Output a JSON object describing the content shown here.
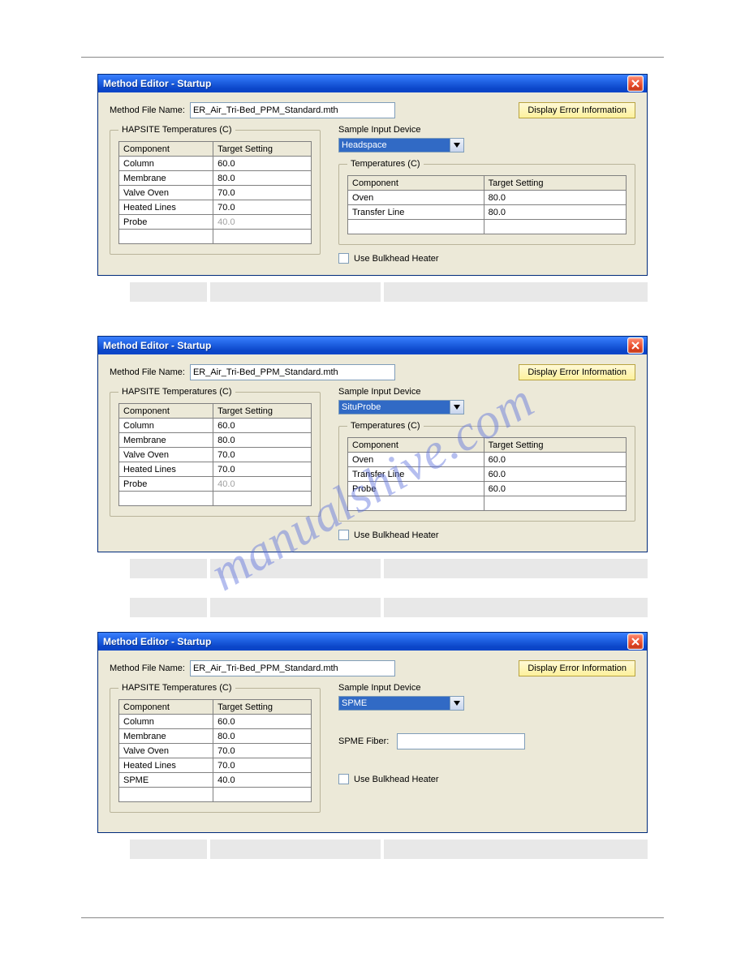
{
  "watermark": "manualshive.com",
  "windows": [
    {
      "title": "Method Editor - Startup",
      "method_label": "Method File Name:",
      "method_value": "ER_Air_Tri-Bed_PPM_Standard.mth",
      "err_button": "Display Error Information",
      "haps_legend": "HAPSITE Temperatures (C)",
      "haps_cols": [
        "Component",
        "Target Setting"
      ],
      "haps_rows": [
        {
          "c": "Column",
          "v": "60.0",
          "dis": false
        },
        {
          "c": "Membrane",
          "v": "80.0",
          "dis": false
        },
        {
          "c": "Valve Oven",
          "v": "70.0",
          "dis": false
        },
        {
          "c": "Heated Lines",
          "v": "70.0",
          "dis": false
        },
        {
          "c": "Probe",
          "v": "40.0",
          "dis": true
        }
      ],
      "sid_label": "Sample Input Device",
      "sid_value": "Headspace",
      "temps_legend": "Temperatures (C)",
      "temps_cols": [
        "Component",
        "Target Setting"
      ],
      "temps_rows": [
        {
          "c": "Oven",
          "v": "80.0"
        },
        {
          "c": "Transfer Line",
          "v": "80.0"
        }
      ],
      "bulkhead_label": "Use Bulkhead Heater",
      "type": "temps"
    },
    {
      "title": "Method Editor - Startup",
      "method_label": "Method File Name:",
      "method_value": "ER_Air_Tri-Bed_PPM_Standard.mth",
      "err_button": "Display Error Information",
      "haps_legend": "HAPSITE Temperatures (C)",
      "haps_cols": [
        "Component",
        "Target Setting"
      ],
      "haps_rows": [
        {
          "c": "Column",
          "v": "60.0",
          "dis": false
        },
        {
          "c": "Membrane",
          "v": "80.0",
          "dis": false
        },
        {
          "c": "Valve Oven",
          "v": "70.0",
          "dis": false
        },
        {
          "c": "Heated Lines",
          "v": "70.0",
          "dis": false
        },
        {
          "c": "Probe",
          "v": "40.0",
          "dis": true
        }
      ],
      "sid_label": "Sample Input Device",
      "sid_value": "SituProbe",
      "temps_legend": "Temperatures (C)",
      "temps_cols": [
        "Component",
        "Target Setting"
      ],
      "temps_rows": [
        {
          "c": "Oven",
          "v": "60.0"
        },
        {
          "c": "Transfer Line",
          "v": "60.0"
        },
        {
          "c": "Probe",
          "v": "60.0"
        }
      ],
      "bulkhead_label": "Use Bulkhead Heater",
      "type": "temps"
    },
    {
      "title": "Method Editor - Startup",
      "method_label": "Method File Name:",
      "method_value": "ER_Air_Tri-Bed_PPM_Standard.mth",
      "err_button": "Display Error Information",
      "haps_legend": "HAPSITE Temperatures (C)",
      "haps_cols": [
        "Component",
        "Target Setting"
      ],
      "haps_rows": [
        {
          "c": "Column",
          "v": "60.0",
          "dis": false
        },
        {
          "c": "Membrane",
          "v": "80.0",
          "dis": false
        },
        {
          "c": "Valve Oven",
          "v": "70.0",
          "dis": false
        },
        {
          "c": "Heated Lines",
          "v": "70.0",
          "dis": false
        },
        {
          "c": "SPME",
          "v": "40.0",
          "dis": false
        }
      ],
      "sid_label": "Sample Input Device",
      "sid_value": "SPME",
      "spme_fiber_label": "SPME Fiber:",
      "spme_fiber_value": "",
      "bulkhead_label": "Use Bulkhead Heater",
      "type": "spme"
    }
  ]
}
